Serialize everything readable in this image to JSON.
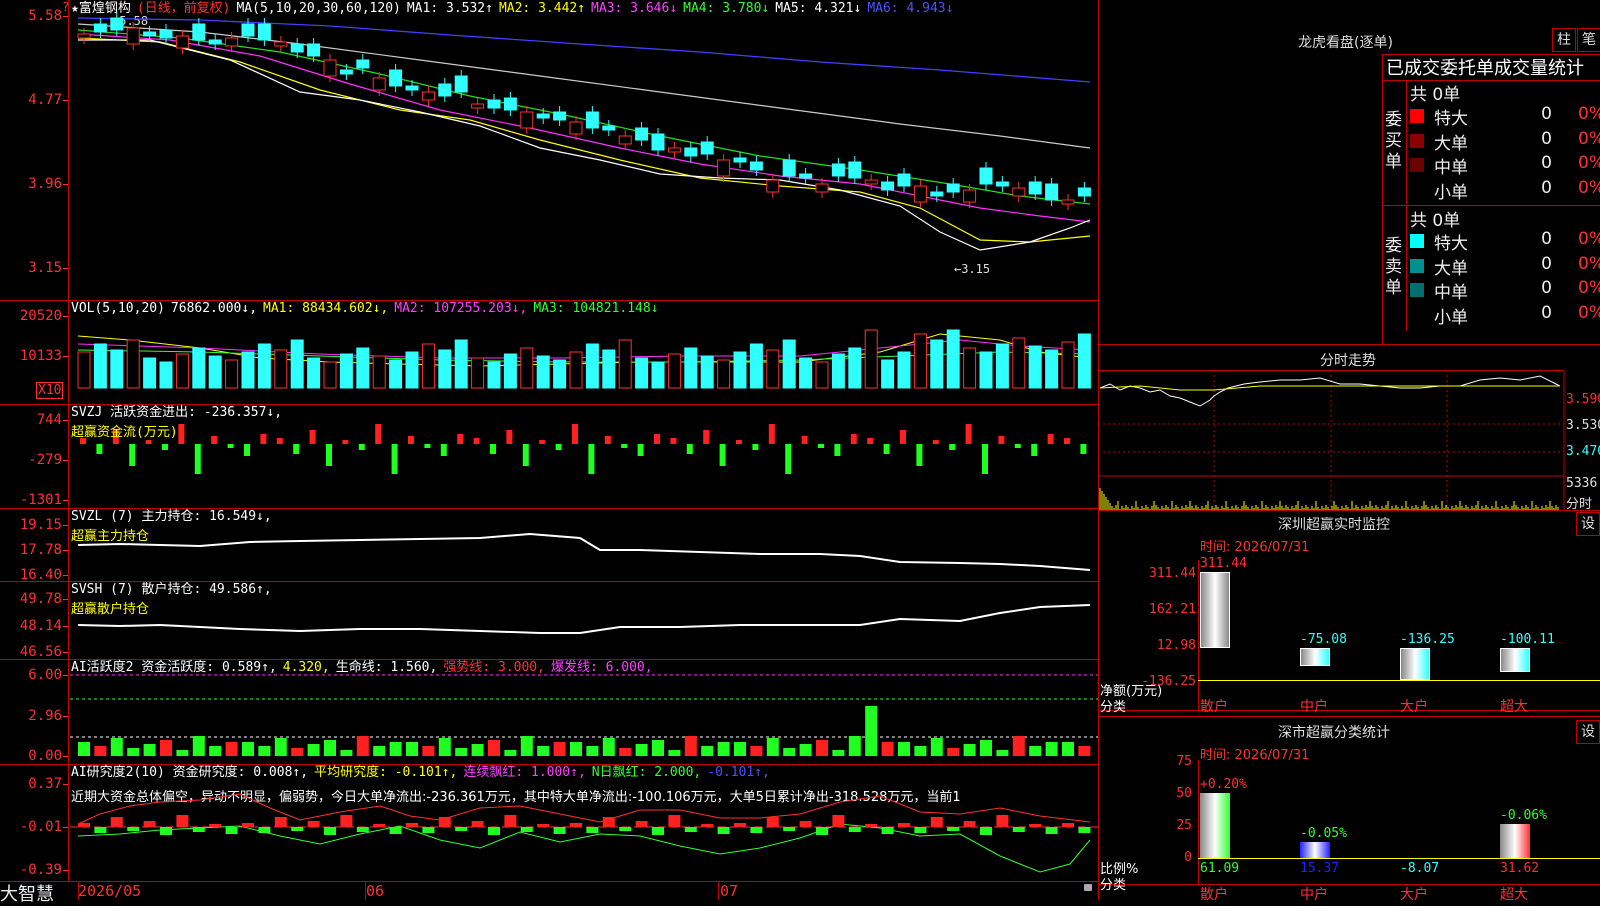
{
  "stock": {
    "name": "★富煌钢构",
    "mode": "(日线，前复权)",
    "ma_params": "MA(5,10,20,30,60,120)"
  },
  "ma": {
    "ma1": "MA1: 3.532↑",
    "ma2": "MA2: 3.442↑",
    "ma3": "MA3: 3.646↓",
    "ma4": "MA4: 3.780↓",
    "ma5": "MA5: 4.321↓",
    "ma6": "MA6: 4.943↓"
  },
  "price": {
    "y_labels": [
      "5.58",
      "4.77",
      "3.96",
      "3.15"
    ],
    "high_mark": "5.58",
    "low_mark": "3.15"
  },
  "vol": {
    "title": "VOL(5,10,20)",
    "value": "76862.000↓,",
    "ma1": "MA1: 88434.602↓,",
    "ma2": "MA2: 107255.203↓,",
    "ma3": "MA3: 104821.148↓",
    "y_labels": [
      "20520",
      "10133"
    ],
    "unit": "X10"
  },
  "svzj": {
    "title": "SVZJ  活跃资金进出: -236.357↓,",
    "sub": "超赢资金流(万元)",
    "y_labels": [
      "744",
      "-279",
      "-1301"
    ]
  },
  "svzl": {
    "title": "SVZL (7) 主力持仓: 16.549↓,",
    "sub": "超赢主力持仓",
    "y_labels": [
      "19.15",
      "17.78",
      "16.40"
    ]
  },
  "svsh": {
    "title": "SVSH (7) 散户持仓: 49.586↑,",
    "sub": "超赢散户持仓",
    "y_labels": [
      "49.78",
      "48.14",
      "46.56"
    ]
  },
  "ai1": {
    "title": "AI活跃度2 资金活跃度: 0.589↑,",
    "v2": "4.320,",
    "v3": "生命线: 1.560,",
    "v4": "强势线: 3.000,",
    "v5": "爆发线: 6.000,",
    "y_labels": [
      "6.00",
      "2.96",
      "0.00"
    ]
  },
  "ai2": {
    "title": "AI研究度2(10) 资金研究度: 0.008↑,",
    "v2": "平均研究度: -0.101↑,",
    "v3": "连续飘红: 1.000↑,",
    "v4": "N日飘红: 2.000,",
    "v5": "-0.101↑,",
    "text": "近期大资金总体偏空，异动不明显，偏弱势，今日大单净流出:-236.361万元，其中特大单净流出:-100.106万元，大单5日累计净出-318.528万元，当前1",
    "y_labels": [
      "0.37",
      "-0.01",
      "-0.39"
    ]
  },
  "xaxis": {
    "labels": [
      "2026/05",
      "06",
      "07"
    ]
  },
  "logo": "大智慧",
  "lhb": {
    "title": "龙虎看盘(逐单)",
    "btn1": "柱",
    "btn2": "笔",
    "heading": "已成交委托单成交量统计",
    "buy": {
      "label": "委买单",
      "total": "共 0单",
      "rows": [
        {
          "name": "特大",
          "n": "0",
          "pct": "0%",
          "color": "#ff0000"
        },
        {
          "name": "大单",
          "n": "0",
          "pct": "0%",
          "color": "#8b0000"
        },
        {
          "name": "中单",
          "n": "0",
          "pct": "0%",
          "color": "#6b0000"
        },
        {
          "name": "小单",
          "n": "0",
          "pct": "0%",
          "color": "#000000"
        }
      ]
    },
    "sell": {
      "label": "委卖单",
      "total": "共 0单",
      "rows": [
        {
          "name": "特大",
          "n": "0",
          "pct": "0%",
          "color": "#00ffff"
        },
        {
          "name": "大单",
          "n": "0",
          "pct": "0%",
          "color": "#009090"
        },
        {
          "name": "中单",
          "n": "0",
          "pct": "0%",
          "color": "#007070"
        },
        {
          "name": "小单",
          "n": "0",
          "pct": "0%",
          "color": "#000000"
        }
      ]
    }
  },
  "fenshi": {
    "title": "分时走势",
    "y_labels": [
      "3.590",
      "3.530",
      "3.470"
    ],
    "vol_label": "5336",
    "vol_unit": "分时"
  },
  "monitor": {
    "title": "深圳超赢实时监控",
    "btn": "设",
    "time": "时间: 2026/07/31",
    "y_labels": [
      "311.44",
      "162.21",
      "12.98",
      "-136.25"
    ],
    "ylabel1": "净额(万元)",
    "ylabel2": "分类",
    "bars": [
      {
        "cat": "散户",
        "value": 311.44,
        "label": "311.44"
      },
      {
        "cat": "中户",
        "value": -75.08,
        "label": "-75.08"
      },
      {
        "cat": "大户",
        "value": -136.25,
        "label": "-136.25"
      },
      {
        "cat": "超大",
        "value": -100.11,
        "label": "-100.11"
      }
    ]
  },
  "stats": {
    "title": "深市超赢分类统计",
    "btn": "设",
    "time": "时间: 2026/07/31",
    "y_labels": [
      "75",
      "50",
      "25",
      "0"
    ],
    "ylabel1": "比例%",
    "ylabel2": "分类",
    "bars": [
      {
        "cat": "散户",
        "top": "+0.20%",
        "bottom": "61.09",
        "value": 61.09
      },
      {
        "cat": "中户",
        "top": "-0.05%",
        "bottom": "15.37",
        "value": 15.37
      },
      {
        "cat": "大户",
        "top": "",
        "bottom": "-8.07",
        "value": 0
      },
      {
        "cat": "超大",
        "top": "-0.06%",
        "bottom": "31.62",
        "value": 31.62
      }
    ]
  }
}
